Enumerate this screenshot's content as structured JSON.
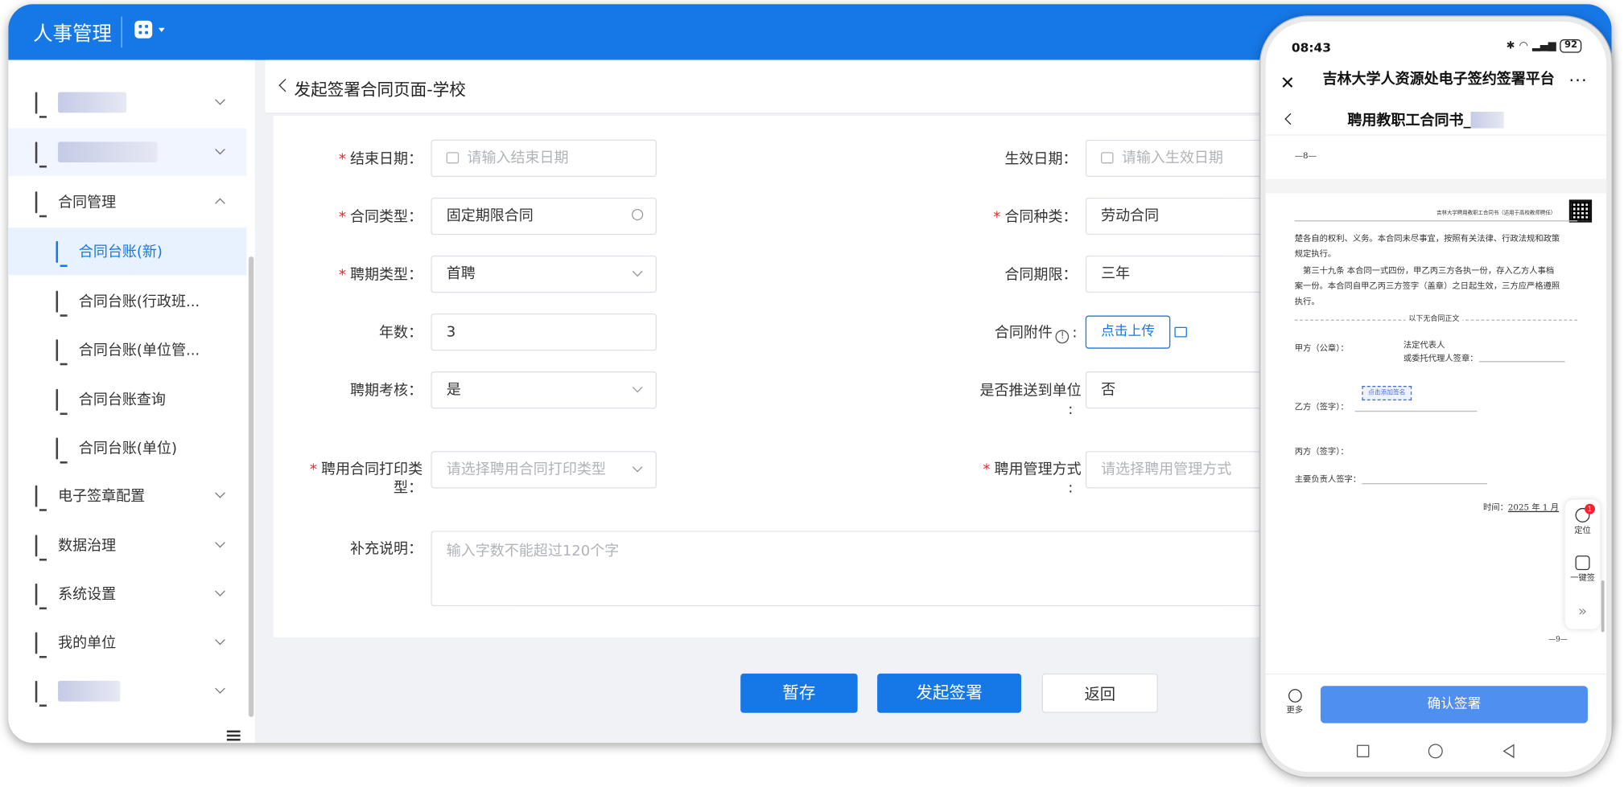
{
  "app": {
    "title": "人事管理"
  },
  "sidebar": {
    "items": [
      {
        "label": "",
        "redacted": true
      },
      {
        "label": "",
        "redacted": true
      },
      {
        "label": "合同管理"
      },
      {
        "label": "合同台账(新)",
        "active": true
      },
      {
        "label": "合同台账(行政班..."
      },
      {
        "label": "合同台账(单位管..."
      },
      {
        "label": "合同台账查询"
      },
      {
        "label": "合同台账(单位)"
      },
      {
        "label": "电子签章配置"
      },
      {
        "label": "数据治理"
      },
      {
        "label": "系统设置"
      },
      {
        "label": "我的单位"
      },
      {
        "label": "",
        "redacted": true
      }
    ]
  },
  "page": {
    "title": "发起签署合同页面-学校"
  },
  "form": {
    "end_date": {
      "label": "结束日期：",
      "placeholder": "请输入结束日期"
    },
    "effective_date": {
      "label": "生效日期：",
      "placeholder": "请输入生效日期"
    },
    "contract_type": {
      "label": "合同类型：",
      "value": "固定期限合同"
    },
    "contract_kind": {
      "label": "合同种类：",
      "value": "劳动合同"
    },
    "hire_type": {
      "label": "聘期类型：",
      "value": "首聘"
    },
    "contract_term": {
      "label": "合同期限：",
      "value": "三年"
    },
    "years": {
      "label": "年数：",
      "value": "3"
    },
    "attachment": {
      "label": "合同附件",
      "suffix": ":",
      "upload_label": "点击上传"
    },
    "assessment": {
      "label": "聘期考核：",
      "value": "是"
    },
    "push_unit": {
      "label_l1": "是否推送到单位",
      "label_l2": ":",
      "value": "否"
    },
    "print_type": {
      "label_l1": "聘用合同打印类",
      "label_l2": "型：",
      "placeholder": "请选择聘用合同打印类型"
    },
    "mgmt_mode": {
      "label_l1": "聘用管理方式",
      "label_l2": ":",
      "placeholder": "请选择聘用管理方式"
    },
    "remarks": {
      "label": "补充说明：",
      "placeholder": "输入字数不能超过120个字"
    }
  },
  "actions": {
    "save": "暂存",
    "initiate": "发起签署",
    "back": "返回"
  },
  "phone": {
    "time": "08:43",
    "battery": "92",
    "app_title": "吉林大学人资源处电子签约签署平台",
    "doc_title": "聘用教职工合同书_",
    "doc": {
      "page_num_top": "—8—",
      "header": "吉林大学聘用教职工合同书（适用于高校教师聘任）",
      "p1": "楚各自的权利、义务。本合同未尽事宜，按照有关法律、行政法规和政策",
      "p1b": "规定执行。",
      "p2": "第三十九条 本合同一式四份，甲乙丙三方各执一份，存入乙方人事档",
      "p2b": "案一份。本合同自甲乙丙三方签字（盖章）之日起生效，三方应严格遵照",
      "p2c": "执行。",
      "sep_text": "以下无合同正文",
      "party_a": "甲方（公章）：",
      "legal_rep": "法定代表人",
      "agent": "或委托代理人签章：",
      "sign_btn": "点击添加签名",
      "party_b": "乙方（签字）：",
      "party_c": "丙方（签字）：",
      "principal": "主要负责人签字：",
      "date_prefix": "时间：",
      "date_val": "2025 年 1 月",
      "page_num": "—9—"
    },
    "tools": {
      "locate": "定位",
      "locate_badge": "1",
      "one_click": "一键签"
    },
    "more": "更多",
    "confirm": "确认签署"
  }
}
